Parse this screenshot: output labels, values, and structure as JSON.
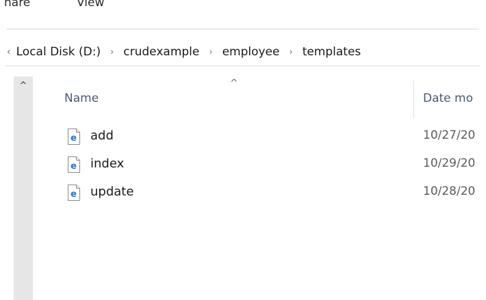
{
  "ribbon": {
    "tabs": [
      {
        "label": "nare"
      },
      {
        "label": "View"
      }
    ]
  },
  "address_bar": {
    "lead_chevron": "‹",
    "separator": "›",
    "crumbs": [
      {
        "label": "Local Disk (D:)"
      },
      {
        "label": "crudexample"
      },
      {
        "label": "employee"
      },
      {
        "label": "templates"
      }
    ]
  },
  "scrollbar": {
    "up_glyph": "^"
  },
  "columns": {
    "name": "Name",
    "date": "Date mo",
    "sort_glyph": "^"
  },
  "files": [
    {
      "name": "add",
      "date": "10/27/20",
      "icon": "html-file-icon"
    },
    {
      "name": "index",
      "date": "10/29/20",
      "icon": "html-file-icon"
    },
    {
      "name": "update",
      "date": "10/28/20",
      "icon": "html-file-icon"
    }
  ],
  "colors": {
    "icon_blue": "#1f6fd0",
    "header_text": "#4a5a72"
  }
}
